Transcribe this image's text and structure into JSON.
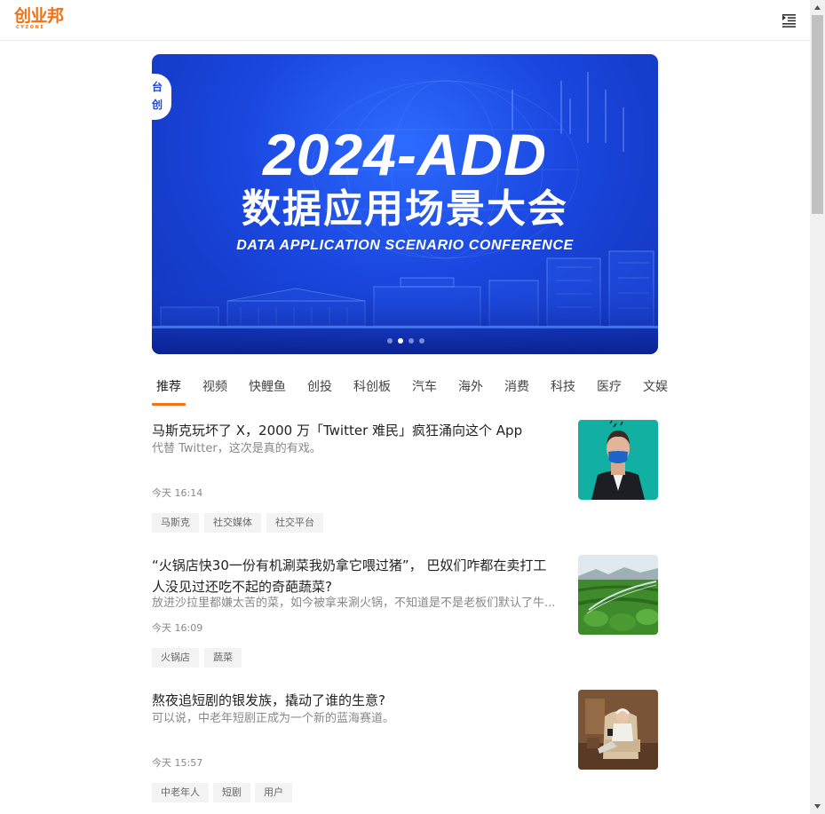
{
  "header": {
    "logo_text": "创业邦",
    "logo_sub": "CYZONE"
  },
  "banner": {
    "title": "2024-ADD",
    "subtitle": "数据应用场景大会",
    "english": "DATA APPLICATION SCENARIO CONFERENCE",
    "badge_text_1": "台",
    "badge_text_2": "创",
    "active_slide": 2,
    "slide_count": 4
  },
  "tabs": [
    {
      "label": "推荐"
    },
    {
      "label": "视频"
    },
    {
      "label": "快鲤鱼"
    },
    {
      "label": "创投"
    },
    {
      "label": "科创板"
    },
    {
      "label": "汽车"
    },
    {
      "label": "海外"
    },
    {
      "label": "消费"
    },
    {
      "label": "科技"
    },
    {
      "label": "医疗"
    },
    {
      "label": "文娱"
    }
  ],
  "articles": [
    {
      "title": "马斯克玩坏了 X，2000 万「Twitter 难民」疯狂涌向这个 App",
      "summary": "代替 Twitter，这次是真的有戏。",
      "time": "今天 16:14",
      "tags": [
        "马斯克",
        "社交媒体",
        "社交平台"
      ],
      "thumb": "man-with-blue-mask-portrait"
    },
    {
      "title": "“火锅店快30一份有机涮菜我奶拿它喂过猪”， 巴奴们咋都在卖打工人没见过还吃不起的奇葩蔬菜?",
      "summary": "放进沙拉里都嫌太苦的菜，如今被拿来涮火锅，不知道是不是老板们默认了牛...",
      "time": "今天 16:09",
      "tags": [
        "火锅店",
        "蔬菜"
      ],
      "thumb": "vegetable-field-irrigation"
    },
    {
      "title": "熬夜追短剧的银发族，撬动了谁的生意?",
      "summary": "可以说，中老年短剧正成为一个新的蓝海赛道。",
      "time": "今天 15:57",
      "tags": [
        "中老年人",
        "短剧",
        "用户"
      ],
      "thumb": "elderly-man-on-armchair-with-phone"
    }
  ]
}
